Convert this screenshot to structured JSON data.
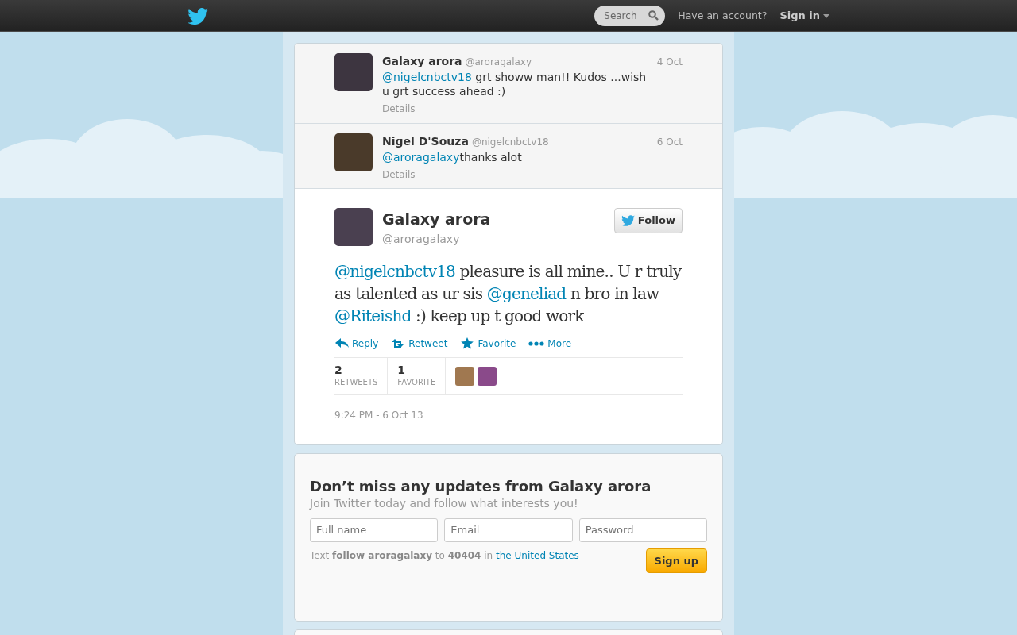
{
  "topbar": {
    "search": {
      "placeholder": "Search"
    },
    "account_prompt": "Have an account?",
    "sign_in": "Sign in"
  },
  "conversation": [
    {
      "name": "Galaxy arora",
      "handle": "@aroragalaxy",
      "date": "4 Oct",
      "segments": [
        {
          "kind": "mention",
          "text": "@nigelcnbctv18"
        },
        {
          "kind": "text",
          "text": " grt showw man!! Kudos ...wish u grt success ahead :)"
        }
      ],
      "details": "Details"
    },
    {
      "name": "Nigel D'Souza",
      "handle": "@nigelcnbctv18",
      "date": "6 Oct",
      "segments": [
        {
          "kind": "mention",
          "text": "@aroragalaxy"
        },
        {
          "kind": "text",
          "text": "thanks alot"
        }
      ],
      "details": "Details"
    }
  ],
  "tweet": {
    "name": "Galaxy arora",
    "handle": "@aroragalaxy",
    "follow": "Follow",
    "segments": [
      {
        "kind": "mention",
        "text": "@nigelcnbctv18"
      },
      {
        "kind": "text",
        "text": " pleasure is all mine.. U r truly as talented as ur sis "
      },
      {
        "kind": "mention",
        "text": "@geneliad"
      },
      {
        "kind": "text",
        "text": " n bro in law "
      },
      {
        "kind": "mention",
        "text": "@Riteishd"
      },
      {
        "kind": "text",
        "text": " :) keep up t good work"
      }
    ],
    "actions": [
      {
        "kind": "reply",
        "label": "Reply"
      },
      {
        "kind": "retweet",
        "label": "Retweet"
      },
      {
        "kind": "favorite",
        "label": "Favorite"
      },
      {
        "kind": "more",
        "label": "More"
      }
    ],
    "stats": [
      {
        "count": "2",
        "label": "RETWEETS"
      },
      {
        "count": "1",
        "label": "FAVORITE"
      }
    ],
    "favoriters": [
      {
        "color": "#a07850"
      },
      {
        "color": "#8a4a8a"
      }
    ],
    "timestamp": "9:24 PM - 6 Oct 13"
  },
  "signup": {
    "title": "Don’t miss any updates from Galaxy arora",
    "subtitle": "Join Twitter today and follow what interests you!",
    "fields": [
      {
        "placeholder": "Full name"
      },
      {
        "placeholder": "Email"
      },
      {
        "placeholder": "Password"
      }
    ],
    "hint": "Text **follow aroragalaxy**  to **40404** in",
    "hint_link": "the United States",
    "button": "Sign up"
  }
}
